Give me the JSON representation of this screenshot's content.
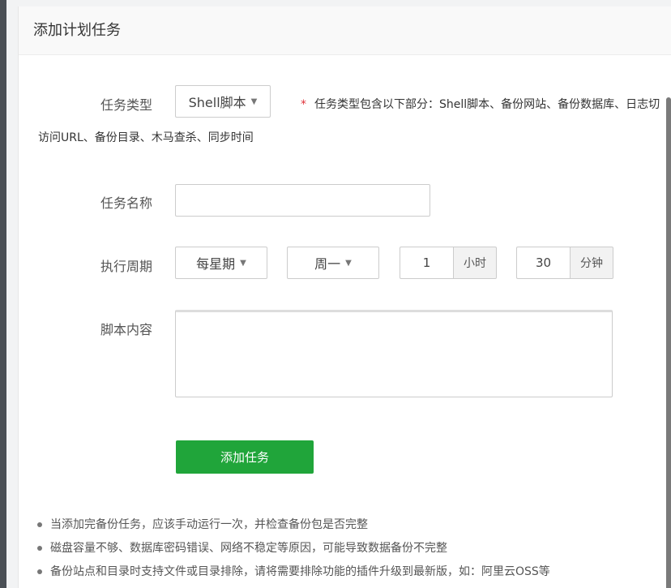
{
  "header": {
    "title": "添加计划任务"
  },
  "form": {
    "task_type": {
      "label": "任务类型",
      "value": "Shell脚本",
      "hint_line1": "任务类型包含以下部分：Shell脚本、备份网站、备份数据库、日志切",
      "hint_line2": "访问URL、备份目录、木马查杀、同步时间"
    },
    "task_name": {
      "label": "任务名称",
      "value": ""
    },
    "period": {
      "label": "执行周期",
      "type_value": "每星期",
      "day_value": "周一",
      "hour_value": "1",
      "hour_unit": "小时",
      "minute_value": "30",
      "minute_unit": "分钟"
    },
    "script": {
      "label": "脚本内容",
      "value": ""
    },
    "submit_label": "添加任务"
  },
  "notes": [
    "当添加完备份任务，应该手动运行一次，并检查备份包是否完整",
    "磁盘容量不够、数据库密码错误、网络不稳定等原因，可能导致数据备份不完整",
    "备份站点和目录时支持文件或目录排除，请将需要排除功能的插件升级到最新版，如：阿里云OSS等"
  ],
  "colors": {
    "primary": "#20a53a",
    "required": "#e0323a"
  }
}
